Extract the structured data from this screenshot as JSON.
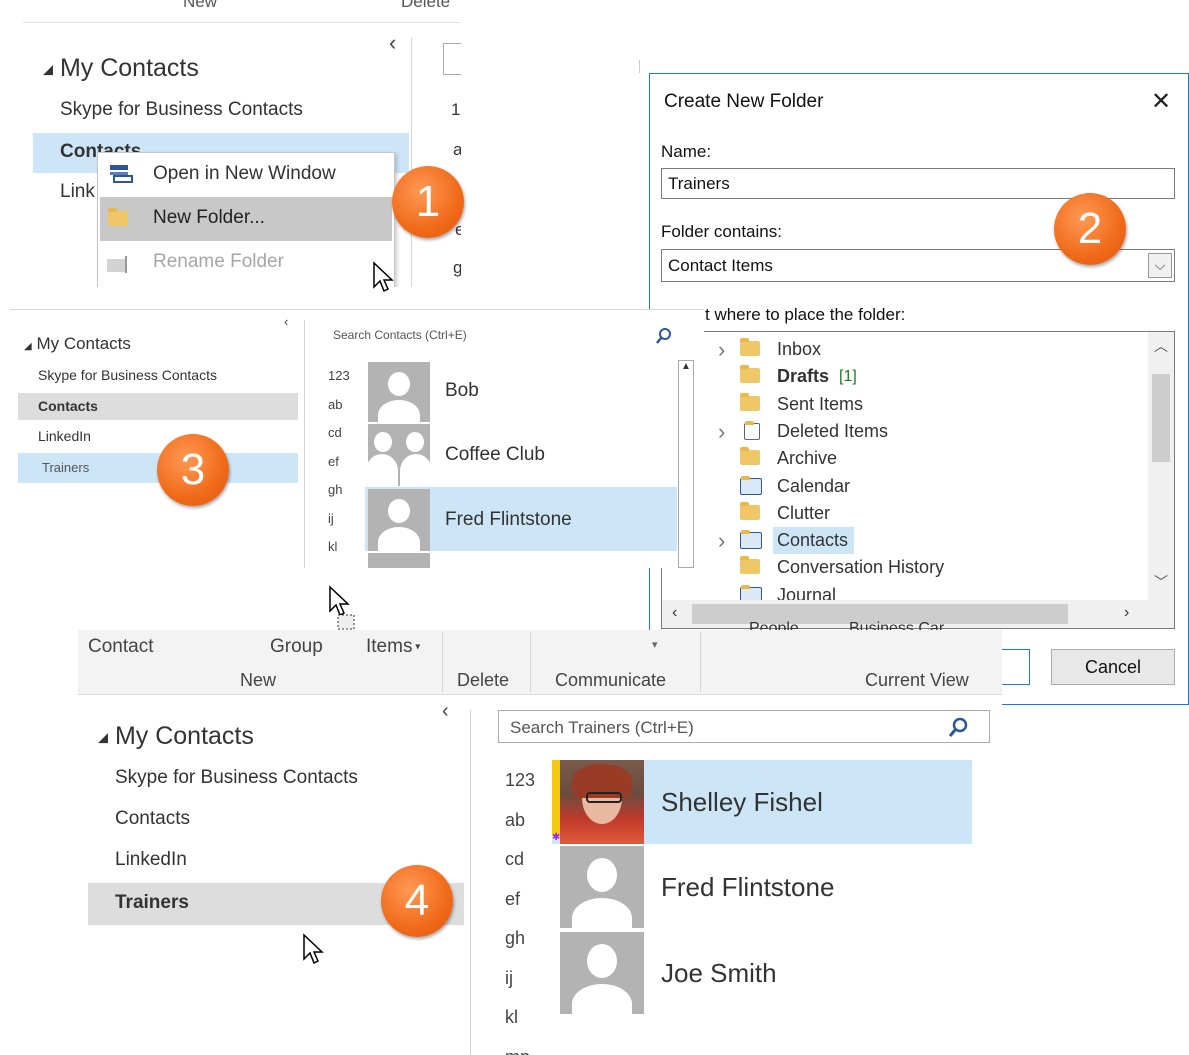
{
  "step_badges": [
    "1",
    "2",
    "3",
    "4"
  ],
  "panel1": {
    "top_tabs": [
      "New",
      "Delete"
    ],
    "collapse_glyph": "‹",
    "my_contacts": "My Contacts",
    "folders": [
      "Skype for Business Contacts",
      "Contacts",
      "Link"
    ],
    "right_letters": [
      "1.",
      "a",
      "e",
      "g"
    ],
    "context_menu": {
      "open_new_window": "Open in New Window",
      "new_folder": "New Folder...",
      "rename_folder": "Rename Folder"
    }
  },
  "dialog": {
    "title": "Create New Folder",
    "close_glyph": "✕",
    "name_label": "Name:",
    "name_value": "Trainers",
    "contains_label": "Folder contains:",
    "contains_value": "Contact Items",
    "place_label": "t where to place the folder:",
    "tree": [
      {
        "label": "Inbox",
        "expandable": true,
        "icon": "inbox-icon"
      },
      {
        "label": "Drafts",
        "count": "[1]",
        "bold": true,
        "icon": "drafts-icon"
      },
      {
        "label": "Sent Items",
        "icon": "sent-items-icon"
      },
      {
        "label": "Deleted Items",
        "expandable": true,
        "icon": "trash-icon"
      },
      {
        "label": "Archive",
        "icon": "folder-icon"
      },
      {
        "label": "Calendar",
        "icon": "calendar-icon"
      },
      {
        "label": "Clutter",
        "icon": "folder-icon"
      },
      {
        "label": "Contacts",
        "expandable": true,
        "selected": true,
        "icon": "contacts-icon"
      },
      {
        "label": "Conversation History",
        "icon": "folder-icon"
      },
      {
        "label": "Journal",
        "icon": "journal-icon"
      }
    ],
    "cancel_label": "Cancel",
    "behind_tabs": [
      "People",
      "Business Car"
    ]
  },
  "panel3": {
    "my_contacts": "My Contacts",
    "folders": [
      "Skype for Business Contacts",
      "Contacts",
      "LinkedIn",
      "Trainers"
    ],
    "search_placeholder": "Search Contacts (Ctrl+E)",
    "letters": [
      "123",
      "ab",
      "cd",
      "ef",
      "gh",
      "ij",
      "kl"
    ],
    "contacts": [
      "Bob",
      "Coffee Club",
      "Fred Flintstone"
    ]
  },
  "panel4": {
    "ribbon": {
      "contact": "Contact",
      "group": "Group",
      "items": "Items",
      "groups": [
        "New",
        "Delete",
        "Communicate",
        "Current View"
      ]
    },
    "my_contacts": "My Contacts",
    "folders": [
      "Skype for Business Contacts",
      "Contacts",
      "LinkedIn",
      "Trainers"
    ],
    "search_placeholder": "Search Trainers (Ctrl+E)",
    "letters": [
      "123",
      "ab",
      "cd",
      "ef",
      "gh",
      "ij",
      "kl",
      "mn"
    ],
    "contacts": [
      "Shelley Fishel",
      "Fred Flintstone",
      "Joe Smith"
    ]
  },
  "colors": {
    "selection": "#cde6f7",
    "badge": "#f06a1a",
    "accent": "#2b579a",
    "folder": "#f0c767"
  }
}
